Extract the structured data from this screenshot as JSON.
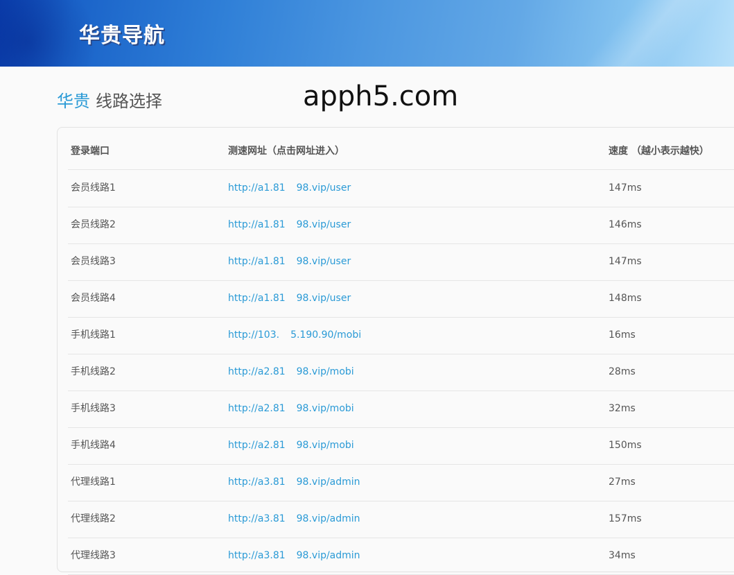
{
  "header": {
    "logo_text": "华贵导航"
  },
  "title": {
    "brand": "华贵",
    "text": "线路选择"
  },
  "watermark": "apph5.com",
  "table": {
    "columns": [
      "登录端口",
      "测速网址（点击网址进入）",
      "速度 （越小表示越快）"
    ],
    "rows": [
      {
        "name": "会员线路1",
        "url_a": "http://a1.81",
        "url_b": "98.vip/user",
        "speed": "147ms"
      },
      {
        "name": "会员线路2",
        "url_a": "http://a1.81",
        "url_b": "98.vip/user",
        "speed": "146ms"
      },
      {
        "name": "会员线路3",
        "url_a": "http://a1.81",
        "url_b": "98.vip/user",
        "speed": "147ms"
      },
      {
        "name": "会员线路4",
        "url_a": "http://a1.81",
        "url_b": "98.vip/user",
        "speed": "148ms"
      },
      {
        "name": "手机线路1",
        "url_a": "http://103.",
        "url_b": "5.190.90/mobi",
        "speed": "16ms"
      },
      {
        "name": "手机线路2",
        "url_a": "http://a2.81",
        "url_b": "98.vip/mobi",
        "speed": "28ms"
      },
      {
        "name": "手机线路3",
        "url_a": "http://a2.81",
        "url_b": "98.vip/mobi",
        "speed": "32ms"
      },
      {
        "name": "手机线路4",
        "url_a": "http://a2.81",
        "url_b": "98.vip/mobi",
        "speed": "150ms"
      },
      {
        "name": "代理线路1",
        "url_a": "http://a3.81",
        "url_b": "98.vip/admin",
        "speed": "27ms"
      },
      {
        "name": "代理线路2",
        "url_a": "http://a3.81",
        "url_b": "98.vip/admin",
        "speed": "157ms"
      },
      {
        "name": "代理线路3",
        "url_a": "http://a3.81",
        "url_b": "98.vip/admin",
        "speed": "34ms"
      }
    ]
  }
}
